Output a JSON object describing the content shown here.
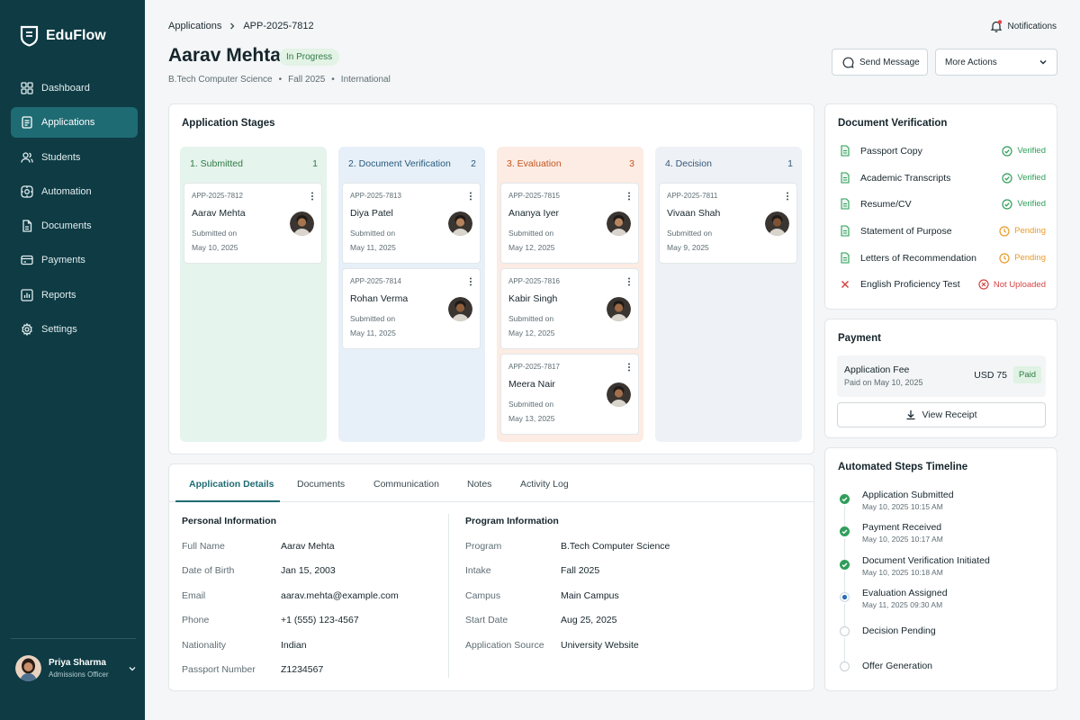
{
  "app": {
    "name": "EduFlow"
  },
  "sidebar": {
    "items": [
      {
        "label": "Dashboard",
        "icon": "grid-icon"
      },
      {
        "label": "Applications",
        "icon": "file-text-icon",
        "active": true
      },
      {
        "label": "Students",
        "icon": "users-icon"
      },
      {
        "label": "Automation",
        "icon": "automation-icon"
      },
      {
        "label": "Documents",
        "icon": "document-icon"
      },
      {
        "label": "Payments",
        "icon": "card-icon"
      },
      {
        "label": "Reports",
        "icon": "bar-chart-icon"
      },
      {
        "label": "Settings",
        "icon": "gear-icon"
      }
    ],
    "user": {
      "name": "Priya Sharma",
      "role": "Admissions Officer"
    }
  },
  "header": {
    "breadcrumb": {
      "root": "Applications",
      "current": "APP-2025-7812"
    },
    "notifications_label": "Notifications",
    "title": "Aarav Mehta",
    "status": "In Progress",
    "meta": [
      "B.Tech Computer Science",
      "Fall 2025",
      "International"
    ],
    "send_message": "Send Message",
    "more_actions": "More Actions"
  },
  "stages": {
    "title": "Application Stages",
    "columns": [
      {
        "title": "1. Submitted",
        "count": "1",
        "bg": "#e5f4ec",
        "color": "#2f7a45",
        "cards": [
          {
            "id": "APP-2025-7812",
            "name": "Aarav Mehta",
            "submitted_label": "Submitted on",
            "date": "May 10, 2025"
          }
        ]
      },
      {
        "title": "2. Document Verification",
        "count": "2",
        "bg": "#e7f0f8",
        "color": "#27597e",
        "cards": [
          {
            "id": "APP-2025-7813",
            "name": "Diya Patel",
            "submitted_label": "Submitted on",
            "date": "May 11, 2025"
          },
          {
            "id": "APP-2025-7814",
            "name": "Rohan Verma",
            "submitted_label": "Submitted on",
            "date": "May 11, 2025"
          }
        ]
      },
      {
        "title": "3. Evaluation",
        "count": "3",
        "bg": "#fcece4",
        "color": "#c4541f",
        "cards": [
          {
            "id": "APP-2025-7815",
            "name": "Ananya Iyer",
            "submitted_label": "Submitted on",
            "date": "May 12, 2025"
          },
          {
            "id": "APP-2025-7816",
            "name": "Kabir Singh",
            "submitted_label": "Submitted on",
            "date": "May 12, 2025"
          },
          {
            "id": "APP-2025-7817",
            "name": "Meera Nair",
            "submitted_label": "Submitted on",
            "date": "May 13, 2025"
          }
        ]
      },
      {
        "title": "4. Decision",
        "count": "1",
        "bg": "#eef1f5",
        "color": "#34567a",
        "cards": [
          {
            "id": "APP-2025-7811",
            "name": "Vivaan Shah",
            "submitted_label": "Submitted on",
            "date": "May 9, 2025"
          }
        ]
      }
    ]
  },
  "tabs": [
    "Application Details",
    "Documents",
    "Communication",
    "Notes",
    "Activity Log"
  ],
  "details": {
    "personal": {
      "title": "Personal Information",
      "fields": [
        {
          "label": "Full Name",
          "value": "Aarav Mehta"
        },
        {
          "label": "Date of Birth",
          "value": "Jan 15, 2003"
        },
        {
          "label": "Email",
          "value": "aarav.mehta@example.com"
        },
        {
          "label": "Phone",
          "value": "+1 (555) 123-4567"
        },
        {
          "label": "Nationality",
          "value": "Indian"
        },
        {
          "label": "Passport Number",
          "value": "Z1234567"
        }
      ]
    },
    "program": {
      "title": "Program Information",
      "fields": [
        {
          "label": "Program",
          "value": "B.Tech Computer Science"
        },
        {
          "label": "Intake",
          "value": "Fall 2025"
        },
        {
          "label": "Campus",
          "value": "Main Campus"
        },
        {
          "label": "Start Date",
          "value": "Aug 25, 2025"
        },
        {
          "label": "Application Source",
          "value": "University Website"
        }
      ]
    }
  },
  "documents": {
    "title": "Document Verification",
    "items": [
      {
        "name": "Passport Copy",
        "status": "Verified",
        "state": "verified"
      },
      {
        "name": "Academic Transcripts",
        "status": "Verified",
        "state": "verified"
      },
      {
        "name": "Resume/CV",
        "status": "Verified",
        "state": "verified"
      },
      {
        "name": "Statement of Purpose",
        "status": "Pending",
        "state": "pending"
      },
      {
        "name": "Letters of Recommendation",
        "status": "Pending",
        "state": "pending"
      },
      {
        "name": "English Proficiency Test",
        "status": "Not Uploaded",
        "state": "missing"
      }
    ]
  },
  "payment": {
    "title": "Payment",
    "fee_label": "Application Fee",
    "paid_on": "Paid on May 10, 2025",
    "amount": "USD 75",
    "status": "Paid",
    "view_receipt": "View Receipt"
  },
  "timeline": {
    "title": "Automated Steps Timeline",
    "steps": [
      {
        "label": "Application Submitted",
        "time": "May 10, 2025 10:15 AM",
        "state": "done"
      },
      {
        "label": "Payment Received",
        "time": "May 10, 2025 10:17 AM",
        "state": "done"
      },
      {
        "label": "Document Verification Initiated",
        "time": "May 10, 2025 10:18 AM",
        "state": "done"
      },
      {
        "label": "Evaluation Assigned",
        "time": "May 11, 2025 09:30 AM",
        "state": "current"
      },
      {
        "label": "Decision Pending",
        "time": "",
        "state": "todo"
      },
      {
        "label": "Offer Generation",
        "time": "",
        "state": "todo"
      }
    ]
  },
  "colors": {
    "sidebar": "#0e3b44",
    "accent": "#1f6b73",
    "verified": "#2f9e5a",
    "pending": "#e89b2b",
    "missing": "#d64545"
  }
}
